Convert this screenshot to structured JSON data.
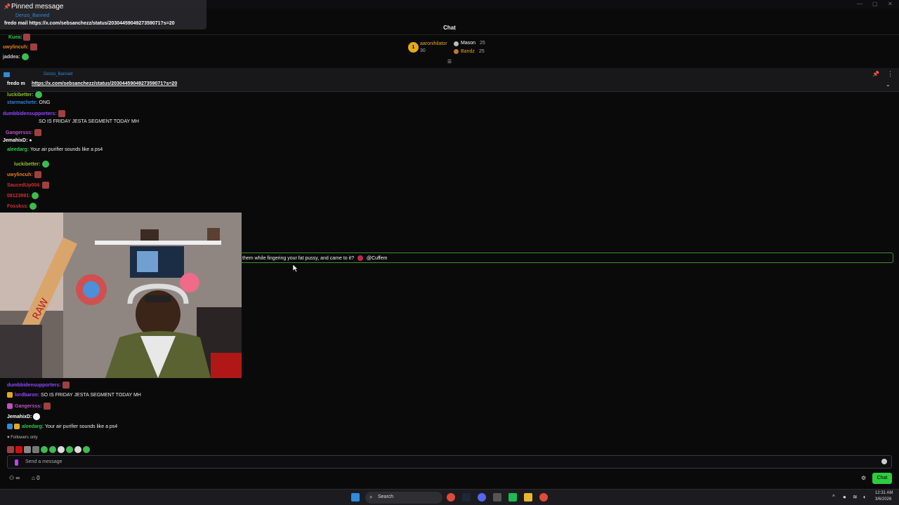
{
  "window": {
    "minimize": "—",
    "maximize": "▢",
    "close": "✕"
  },
  "pinned_overlay": {
    "title": "Pinned message",
    "author": "Denzo_Banned",
    "message": "fredo mail https://x.com/sebsanchezz/status/2030445904927359071?s=20"
  },
  "header": {
    "title": "Chat"
  },
  "leaderboard": [
    {
      "rank": "1",
      "name": "aaronihilator",
      "score": "30"
    },
    {
      "rank": "",
      "name": "Mason",
      "score": "25"
    },
    {
      "rank": "",
      "name": "Bandz",
      "score": "25"
    }
  ],
  "pinned_bar": {
    "author": "Denzo_Banned",
    "prefix": "fredo m",
    "link": "https://x.com/sebsanchezz/status/2030445904927359071?s=20"
  },
  "bg_chat": [
    {
      "user": "Kuea:",
      "text": "",
      "color": "#2ecc40"
    },
    {
      "user": "uwylincuh:",
      "text": "",
      "color": "#e67e22"
    },
    {
      "user": "jaddea:",
      "text": "",
      "color": "#ccc"
    },
    {
      "user": "luckibetter:",
      "text": "",
      "color": "#8fbf30"
    },
    {
      "user": "starmachete:",
      "text": "ONG",
      "color": "#2f7fd8"
    },
    {
      "user": "dumbbidensupporters:",
      "text": "",
      "color": "#9146ff"
    },
    {
      "user": "",
      "text": "SO IS FRIDAY JESTA SEGMENT TODAY MH",
      "color": "#fff"
    },
    {
      "user": "Gangersss:",
      "text": "",
      "color": "#c050c0"
    },
    {
      "user": "JemahixD:",
      "text": "",
      "color": "#fff"
    },
    {
      "user": "aleedarg:",
      "text": "Your air purifier sounds like a ps4",
      "color": "#2ecc40"
    },
    {
      "user": "luckibetter:",
      "text": "",
      "color": "#8fbf30"
    },
    {
      "user": "uwylincuh:",
      "text": "",
      "color": "#e67e22"
    },
    {
      "user": "SaucedUp004:",
      "text": "",
      "color": "#d03030"
    },
    {
      "user": "08123991:",
      "text": "",
      "color": "#d03030"
    },
    {
      "user": "Fosskss:",
      "text": "",
      "color": "#d03030"
    }
  ],
  "highlight": {
    "text": "them while fingering your fat pussy, and came to it?",
    "mention": "@Cuffem"
  },
  "chat": [
    {
      "user": "dumbbidensupporters:",
      "text": "",
      "color": "#9146ff"
    },
    {
      "user": "lordbaron:",
      "text": "SO IS FRIDAY JESTA SEGMENT TODAY MH",
      "color": "#9146ff"
    },
    {
      "user": "Gangersss:",
      "text": "",
      "color": "#c050c0"
    },
    {
      "user": "JemahixD:",
      "text": "",
      "color": "#fff"
    },
    {
      "user": "aleedarg:",
      "text": "Your air purifier sounds like a ps4",
      "color": "#2ecc40"
    }
  ],
  "followers_only": "Followers only",
  "composer": {
    "placeholder": "Send a message"
  },
  "bottom": {
    "viewers": "∞",
    "points": "0",
    "chat_button": "Chat"
  },
  "taskbar": {
    "search": "Search",
    "time": "12:31 AM",
    "date": "3/6/2026"
  }
}
